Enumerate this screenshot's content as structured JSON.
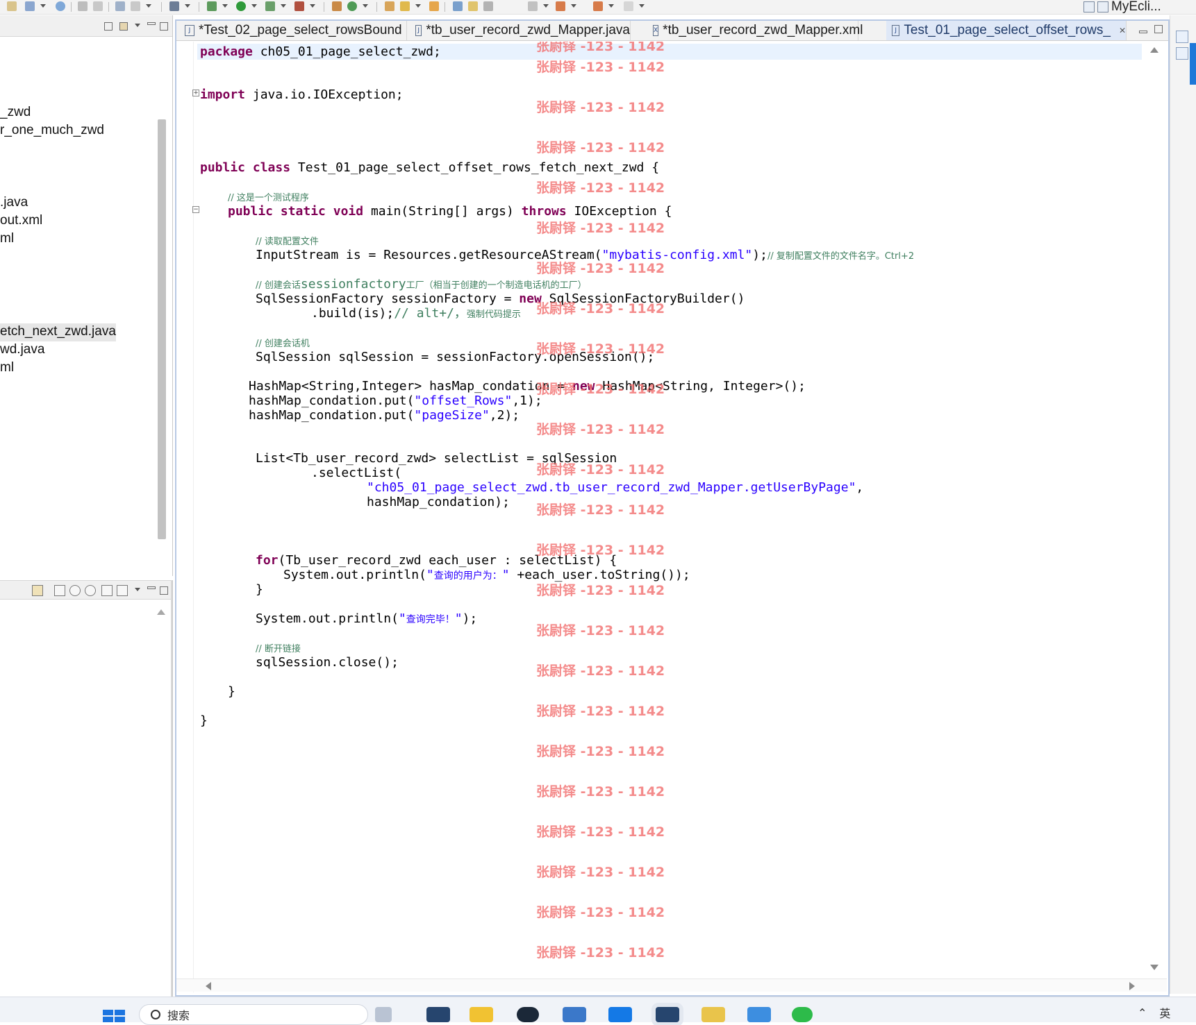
{
  "perspective": {
    "label": "MyEcli..."
  },
  "explorer": {
    "items": [
      {
        "label": "_zwd",
        "selected": false
      },
      {
        "label": "r_one_much_zwd",
        "selected": false
      },
      {
        "label": ".java",
        "selected": false
      },
      {
        "label": "out.xml",
        "selected": false
      },
      {
        "label": "ml",
        "selected": false
      },
      {
        "label": "etch_next_zwd.java",
        "selected": true
      },
      {
        "label": "wd.java",
        "selected": false
      },
      {
        "label": "ml",
        "selected": false
      }
    ]
  },
  "tabs": [
    {
      "label": "*Test_02_page_select_rowsBound",
      "icon": "java-file-icon",
      "active": false
    },
    {
      "label": "*tb_user_record_zwd_Mapper.java",
      "icon": "java-file-icon",
      "active": false
    },
    {
      "label": "*tb_user_record_zwd_Mapper.xml",
      "icon": "xml-file-icon",
      "active": false
    },
    {
      "label": "Test_01_page_select_offset_rows_",
      "icon": "java-file-icon",
      "active": true,
      "close": "✕"
    }
  ],
  "code": {
    "l_package_kw": "package",
    "l_package_name": " ch05_01_page_select_zwd;",
    "l_import_kw": "import",
    "l_import_name": " java.io.IOException;",
    "l_class_kw1": "public",
    "l_class_kw2": "class",
    "l_class_name": " Test_01_page_select_offset_rows_fetch_next_zwd {",
    "c_test": "// 这是一个测试程序",
    "l_main_kw1": "public",
    "l_main_kw2": "static",
    "l_main_kw3": "void",
    "l_main_mid": " main(String[] args) ",
    "l_main_kw4": "throws",
    "l_main_end": " IOException {",
    "c_read": "// 读取配置文件",
    "l_is_pre": "InputStream is = Resources.getResourceAStream(",
    "l_is_str": "\"mybatis-config.xml\"",
    "l_is_post": ");",
    "c_copy": "// 复制配置文件的文件名字。Ctrl+2",
    "c_factory_a": "// 创建会话",
    "c_factory_b": "sessionfactory",
    "c_factory_c": "工厂（相当于创建的一个制造电话机的工厂）",
    "l_sf_pre": "SqlSessionFactory sessionFactory = ",
    "l_sf_kw": "new",
    "l_sf_post": " SqlSessionFactoryBuilder()",
    "l_build": ".build(is);",
    "c_alt": "// alt+/，",
    "c_alt_cn": "强制代码提示",
    "c_session": "// 创建会话机",
    "l_ss": "SqlSession sqlSession = sessionFactory.openSession();",
    "l_hm_pre": "HashMap<String,Integer> hasMap_condation = ",
    "l_hm_kw": "new",
    "l_hm_post": " HashMap<String, Integer>();",
    "l_put1_pre": "hashMap_condation.put(",
    "l_put1_str": "\"offset_Rows\"",
    "l_put1_post": ",1);",
    "l_put2_pre": "hashMap_condation.put(",
    "l_put2_str": "\"pageSize\"",
    "l_put2_post": ",2);",
    "l_list": "List<Tb_user_record_zwd> selectList = sqlSession",
    "l_sel": ".selectList(",
    "l_sel_str": "\"ch05_01_page_select_zwd.tb_user_record_zwd_Mapper.getUserByPage\"",
    "l_sel_comma": ",",
    "l_sel_arg": "hashMap_condation);",
    "l_for_kw": "for",
    "l_for_post": "(Tb_user_record_zwd each_user : selectList) {",
    "l_print_pre": "System.out.println(",
    "l_print_str_a": "\"",
    "l_print_str_cn": "查询的用户为：",
    "l_print_str_b": "\"",
    "l_print_post": " +each_user.toString());",
    "l_close_brace1": "}",
    "l_done_pre": "System.out.println(",
    "l_done_str_a": "\"",
    "l_done_str_cn": "查询完毕！",
    "l_done_str_b": "\"",
    "l_done_post": ");",
    "c_disconnect": "// 断开链接",
    "l_close": "sqlSession.close();",
    "l_close_brace2": "}",
    "l_close_brace3": "}"
  },
  "watermark": {
    "text": "张尉铎 -123 - 1142"
  },
  "taskbar": {
    "search_placeholder": "搜索",
    "lang": "英"
  },
  "colors": {
    "keyword": "#7f0055",
    "string": "#2a00ff",
    "comment": "#3f7f5f",
    "watermark": "#f26b6b",
    "current_line": "#e8f2fe"
  }
}
